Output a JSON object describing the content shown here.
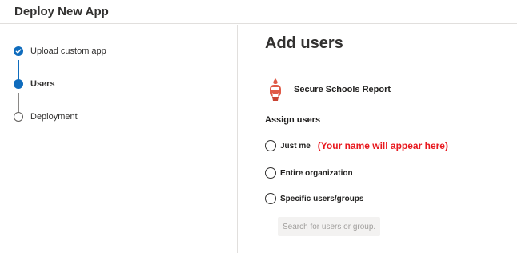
{
  "header": {
    "title": "Deploy New App"
  },
  "steps": [
    {
      "label": "Upload custom app",
      "state": "done"
    },
    {
      "label": "Users",
      "state": "current"
    },
    {
      "label": "Deployment",
      "state": "pending"
    }
  ],
  "main": {
    "title": "Add users",
    "app": {
      "name": "Secure Schools Report",
      "icon": "shield-face-icon",
      "icon_color": "#e05a47"
    },
    "assign_label": "Assign users",
    "options": [
      {
        "label": "Just me",
        "note": "(Your name will appear here)"
      },
      {
        "label": "Entire organization"
      },
      {
        "label": "Specific users/groups"
      }
    ],
    "search": {
      "placeholder": "Search for users or group..."
    }
  },
  "colors": {
    "accent": "#0f6cbd",
    "note": "#e8191f"
  }
}
